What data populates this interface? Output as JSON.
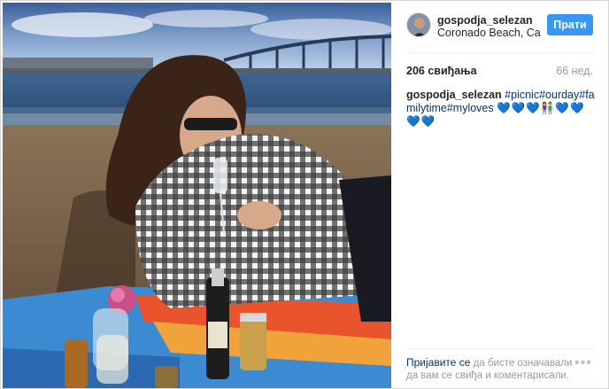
{
  "post": {
    "username": "gospodja_selezan",
    "location": "Coronado Beach, Ca",
    "follow_label": "Прати",
    "likes": "206 свиђања",
    "timestamp": "66 нед.",
    "caption": {
      "username": "gospodja_selezan",
      "hashtags": "#picnic#ourday#familytime#myloves",
      "emojis": "💙💙💙👫💙💙💙💙"
    },
    "login_prompt": {
      "link": "Пријавите се",
      "text": " да бисте означавали да вам се свиђа и коментарисали."
    },
    "more_icon": "ellipsis-icon"
  },
  "colors": {
    "accent": "#3897f0",
    "link": "#003569",
    "muted": "#999999"
  }
}
